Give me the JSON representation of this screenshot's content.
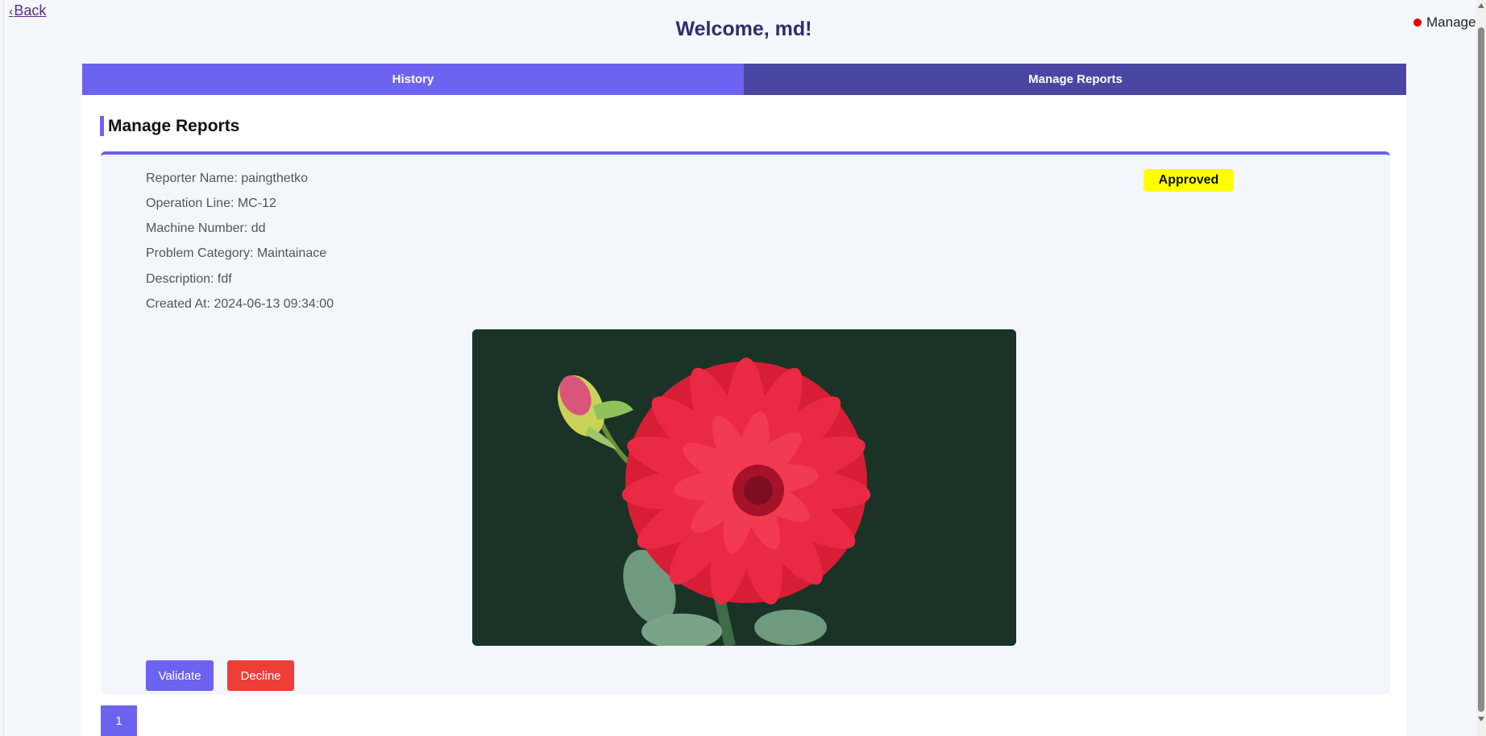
{
  "nav": {
    "back_label": "Back"
  },
  "header": {
    "welcome": "Welcome, md!",
    "role": "Manager"
  },
  "tabs": [
    {
      "label": "History"
    },
    {
      "label": "Manage Reports"
    }
  ],
  "section": {
    "title": "Manage Reports"
  },
  "report": {
    "fields": [
      "Reporter Name: paingthetko",
      "Operation Line: MC-12",
      "Machine Number: dd",
      "Problem Category: Maintainace",
      "Description: fdf",
      "Created At: 2024-06-13 09:34:00"
    ],
    "status": "Approved",
    "image_subject": "red-dahlia-flower",
    "validate_label": "Validate",
    "decline_label": "Decline"
  },
  "pagination": {
    "current_page": "1"
  },
  "colors": {
    "primary": "#6c63f0",
    "tab_active": "#4a47a3",
    "danger": "#ef3e36",
    "status_approved": "#ffff00",
    "role_indicator": "#e60000"
  }
}
